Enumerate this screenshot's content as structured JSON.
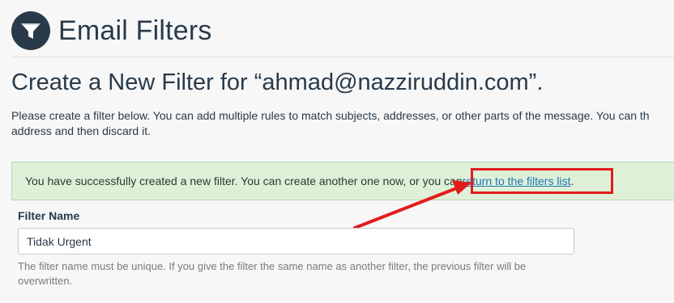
{
  "header": {
    "title": "Email Filters",
    "icon": "funnel-icon"
  },
  "page": {
    "subtitle": "Create a New Filter for “ahmad@nazziruddin.com”.",
    "description": "Please create a filter below. You can add multiple rules to match subjects, addresses, or other parts of the message. You can th\naddress and then discard it."
  },
  "alert": {
    "message": "You have successfully created a new filter. You can create another one now, or you can ",
    "link_text": "return to the filters list",
    "suffix": "."
  },
  "form": {
    "filter_name_label": "Filter Name",
    "filter_name_value": "Tidak Urgent",
    "filter_name_help": "The filter name must be unique. If you give the filter the same name as another filter, the previous filter will be overwritten."
  },
  "annotation": {
    "color": "#e31b1b"
  }
}
